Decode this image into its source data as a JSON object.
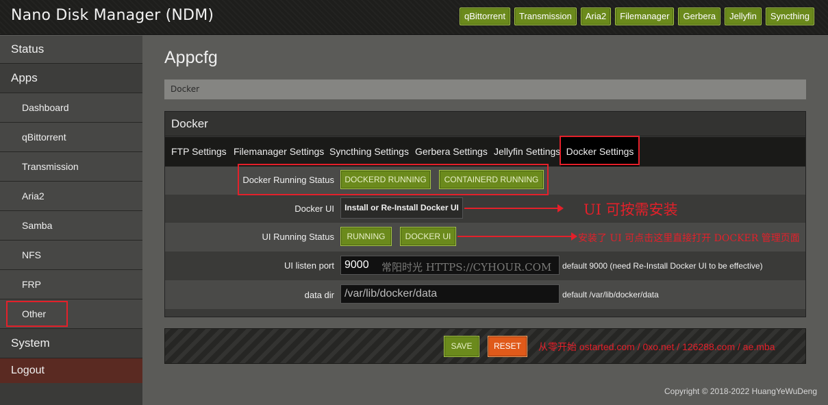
{
  "header": {
    "title": "Nano Disk Manager (NDM)",
    "links": [
      "qBittorrent",
      "Transmission",
      "Aria2",
      "Filemanager",
      "Gerbera",
      "Jellyfin",
      "Syncthing"
    ]
  },
  "sidebar": {
    "items": [
      "Status",
      "Apps",
      "Dashboard",
      "qBittorrent",
      "Transmission",
      "Aria2",
      "Samba",
      "NFS",
      "FRP",
      "Other",
      "System",
      "Logout"
    ]
  },
  "main": {
    "page_title": "Appcfg",
    "breadcrumb": "Docker",
    "panel_title": "Docker",
    "tabs": [
      "FTP Settings",
      "Filemanager Settings",
      "Syncthing Settings",
      "Gerbera Settings",
      "Jellyfin Settings",
      "Docker Settings"
    ],
    "running_status": {
      "label": "Docker Running Status",
      "dockerd": "DOCKERD RUNNING",
      "containerd": "CONTAINERD RUNNING"
    },
    "docker_ui": {
      "label": "Docker UI",
      "button": "Install or Re-Install Docker UI",
      "annotation": "UI 可按需安装"
    },
    "ui_status": {
      "label": "UI Running Status",
      "running": "RUNNING",
      "open": "DOCKER UI",
      "annotation": "安装了 UI 可点击这里直接打开 DOCKER 管理页面"
    },
    "listen_port": {
      "label": "UI listen port",
      "value": "9000",
      "watermark": "常阳时光 HTTPS://CYHOUR.COM",
      "hint": "default 9000 (need Re-Install Docker UI to be effective)"
    },
    "data_dir": {
      "label": "data dir",
      "value": "/var/lib/docker/data",
      "hint": "default /var/lib/docker/data"
    },
    "actions": {
      "save": "SAVE",
      "reset": "RESET",
      "note": "从零开始 ostarted.com / 0xo.net / 126288.com / ae.mba"
    },
    "copyright": "Copyright © 2018-2022 HuangYeWuDeng"
  },
  "colors": {
    "accent_green": "#6b8a1c",
    "reset_orange": "#e05a1a",
    "annotation_red": "#e4202a",
    "logout_bg": "#5a2a22"
  }
}
